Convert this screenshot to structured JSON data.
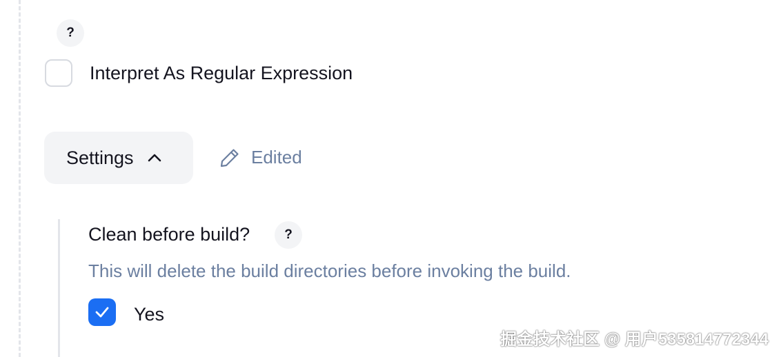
{
  "regex_option": {
    "help_label": "?",
    "label": "Interpret As Regular Expression",
    "checked": false
  },
  "settings": {
    "toggle_label": "Settings",
    "toggle_icon": "chevron-up-icon",
    "expanded": true,
    "status_icon": "pencil-icon",
    "status_label": "Edited"
  },
  "clean_before_build": {
    "title": "Clean before build?",
    "help_label": "?",
    "description": "This will delete the build directories before invoking the build.",
    "option_label": "Yes",
    "checked": true
  },
  "colors": {
    "accent": "#1b6ef3",
    "muted_text": "#6b7fa0",
    "chip_bg": "#f3f4f6",
    "border": "#d7dae0"
  },
  "watermark": "掘金技术社区 @ 用户535814772344"
}
